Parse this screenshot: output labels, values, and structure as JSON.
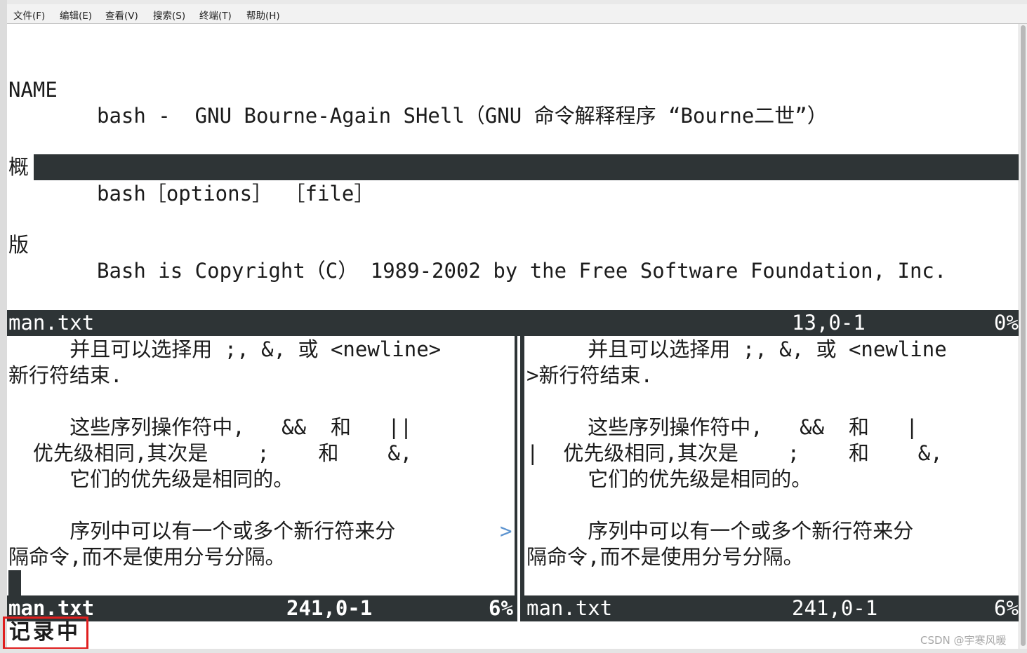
{
  "menubar": {
    "file": "文件(F)",
    "edit": "编辑(E)",
    "view": "查看(V)",
    "search": "搜索(S)",
    "terminal": "终端(T)",
    "help": "帮助(H)"
  },
  "top_pane": {
    "heading_name": "NAME",
    "name_line": "bash -  GNU Bourne-Again SHell（GNU 命令解释程序 “Bourne二世”）",
    "heading_synopsis": "概",
    "synopsis_line": "bash［options］ ［file］",
    "heading_copyright": "版",
    "copyright_line": "Bash is Copyright（C） 1989-2002 by the Free Software Foundation, Inc."
  },
  "top_status": {
    "filename": "man.txt",
    "position": "13,0-1",
    "percent": "0%"
  },
  "left_pane": {
    "line1": "     并且可以选择用 ;, &, 或 <newline>",
    "line2": "新行符结束.",
    "line3": "     这些序列操作符中,   &&  和   ||",
    "line4": "  优先级相同,其次是    ;    和    &,",
    "line5": "     它们的优先级是相同的。",
    "line6": "     序列中可以有一个或多个新行符来分",
    "line6_marker": ">",
    "line7": "隔命令,而不是使用分号分隔。"
  },
  "left_status": {
    "filename": "man.txt",
    "position": "241,0-1",
    "percent": "6%"
  },
  "right_pane": {
    "line1": "     并且可以选择用 ;, &, 或 <newline",
    "line2": ">新行符结束.",
    "line3": "     这些序列操作符中,   &&  和   |",
    "line4": "|  优先级相同,其次是    ;    和    &,",
    "line5": "     它们的优先级是相同的。",
    "line6": "     序列中可以有一个或多个新行符来分",
    "line7": "隔命令,而不是使用分号分隔。"
  },
  "right_status": {
    "filename": "man.txt",
    "position": "241,0-1",
    "percent": "6%"
  },
  "mode_indicator": "记录中",
  "watermark": "CSDN @宇寒风暖",
  "colors": {
    "status_bar": "#2e3436",
    "highlight_box": "#e01e1e",
    "wrap_marker": "#5e95d0"
  }
}
